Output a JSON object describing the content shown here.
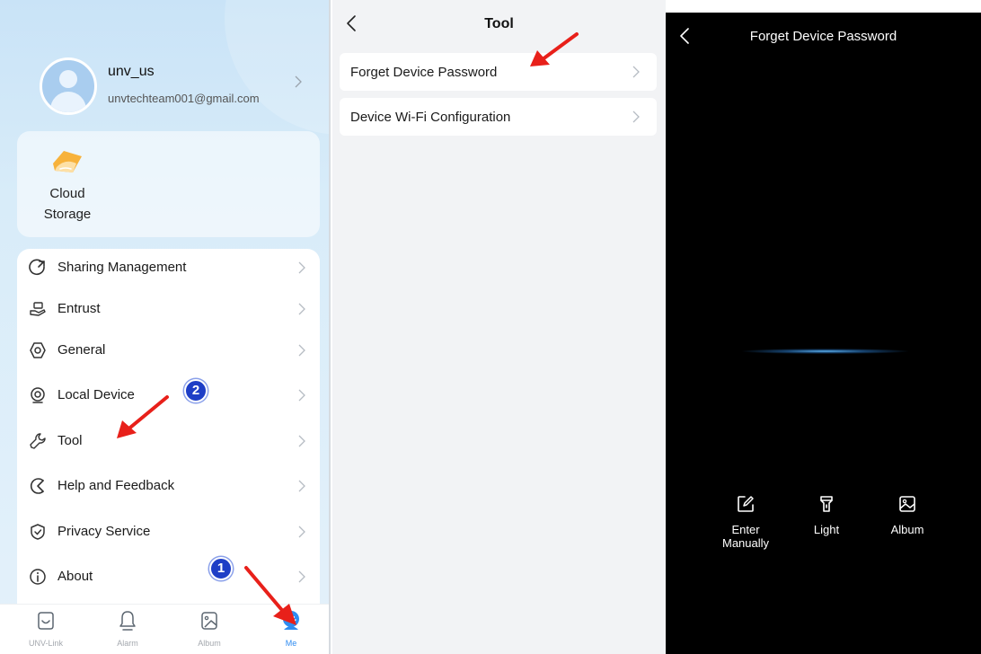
{
  "me": {
    "profile": {
      "username": "unv_us",
      "email": "unvtechteam001@gmail.com"
    },
    "cloud_storage": {
      "label": "Cloud\nStorage",
      "icon": "cloud-storage-icon",
      "icon_color": "#f7b23b"
    },
    "menu": [
      {
        "label": "Sharing Management",
        "icon": "share-icon"
      },
      {
        "label": "Entrust",
        "icon": "entrust-icon"
      },
      {
        "label": "General",
        "icon": "general-settings-icon"
      },
      {
        "label": "Local Device",
        "icon": "local-device-icon"
      },
      {
        "label": "Tool",
        "icon": "tool-icon"
      },
      {
        "label": "Help and Feedback",
        "icon": "help-feedback-icon"
      },
      {
        "label": "Privacy Service",
        "icon": "privacy-shield-icon"
      },
      {
        "label": "About",
        "icon": "info-icon"
      }
    ],
    "tabs": [
      {
        "label": "UNV-Link",
        "icon": "unv-link-icon",
        "active": false
      },
      {
        "label": "Alarm",
        "icon": "bell-icon",
        "active": false
      },
      {
        "label": "Album",
        "icon": "album-icon",
        "active": false
      },
      {
        "label": "Me",
        "icon": "me-icon",
        "active": true
      }
    ]
  },
  "tool": {
    "title": "Tool",
    "items": [
      {
        "label": "Forget Device Password"
      },
      {
        "label": "Device Wi-Fi Configuration"
      }
    ]
  },
  "scanner": {
    "title": "Forget Device Password",
    "actions": [
      {
        "label": "Enter\nManually",
        "icon": "edit-icon"
      },
      {
        "label": "Light",
        "icon": "flashlight-icon"
      },
      {
        "label": "Album",
        "icon": "gallery-icon"
      }
    ]
  },
  "annotations": {
    "step1": "1",
    "step2": "2"
  },
  "colors": {
    "accent": "#2f8cf0",
    "arrow_red": "#e8201a",
    "badge_blue": "#1e3ec6",
    "panel_me_bg": "#d8ecf9",
    "panel_tool_bg": "#f2f3f5",
    "scanner_bg": "#000000"
  }
}
